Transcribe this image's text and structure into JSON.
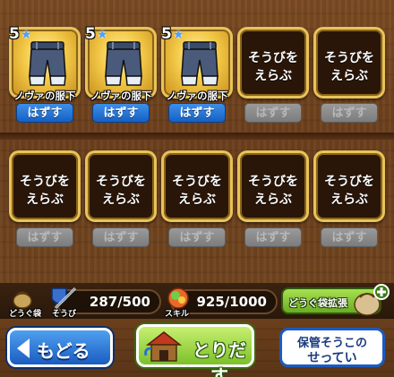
{
  "equip_slots": [
    {
      "filled": true,
      "level": "5",
      "item_name": "ノヴァの服下",
      "remove_label": "はずす",
      "remove_enabled": true
    },
    {
      "filled": true,
      "level": "5",
      "item_name": "ノヴァの服下",
      "remove_label": "はずす",
      "remove_enabled": true
    },
    {
      "filled": true,
      "level": "5",
      "item_name": "ノヴァの服下",
      "remove_label": "はずす",
      "remove_enabled": true
    },
    {
      "filled": false,
      "empty_label": "そうびを\nえらぶ",
      "remove_label": "はずす",
      "remove_enabled": false
    },
    {
      "filled": false,
      "empty_label": "そうびを\nえらぶ",
      "remove_label": "はずす",
      "remove_enabled": false
    },
    {
      "filled": false,
      "empty_label": "そうびを\nえらぶ",
      "remove_label": "はずす",
      "remove_enabled": false
    },
    {
      "filled": false,
      "empty_label": "そうびを\nえらぶ",
      "remove_label": "はずす",
      "remove_enabled": false
    },
    {
      "filled": false,
      "empty_label": "そうびを\nえらぶ",
      "remove_label": "はずす",
      "remove_enabled": false
    },
    {
      "filled": false,
      "empty_label": "そうびを\nえらぶ",
      "remove_label": "はずす",
      "remove_enabled": false
    },
    {
      "filled": false,
      "empty_label": "そうびを\nえらぶ",
      "remove_label": "はずす",
      "remove_enabled": false
    }
  ],
  "status": {
    "bag_label": "どうぐ袋",
    "equip_label": "そうび",
    "equip_count": "287/500",
    "skill_label": "スキル",
    "skill_count": "925/1000",
    "expand_label": "どうぐ袋拡張"
  },
  "buttons": {
    "back_label": "もどる",
    "take_out_label": "とりだす",
    "storage_line1": "保管そうこの",
    "storage_line2": "せってい"
  },
  "colors": {
    "accent_gold": "#e8c35a",
    "button_blue": "#1560c4",
    "button_green": "#8ccf3a"
  }
}
